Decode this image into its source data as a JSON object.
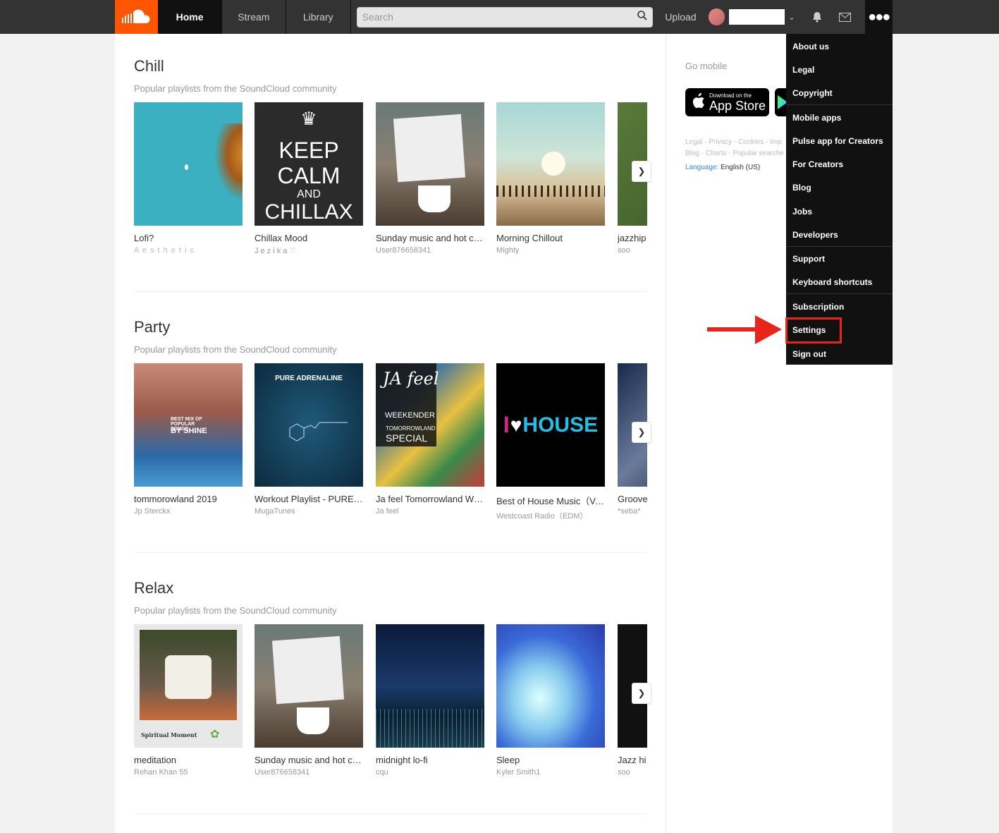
{
  "nav": {
    "tabs": [
      {
        "label": "Home"
      },
      {
        "label": "Stream"
      },
      {
        "label": "Library"
      }
    ],
    "search_placeholder": "Search",
    "upload_label": "Upload"
  },
  "sections": [
    {
      "title": "Chill",
      "subtitle": "Popular playlists from the SoundCloud community",
      "cards": [
        {
          "title": "Lofi?",
          "user": "A e s t h e t i c"
        },
        {
          "title": "Chillax Mood",
          "user": "J e z i k a ♡",
          "art_text": [
            "KEEP",
            "CALM",
            "AND",
            "CHILLAX"
          ]
        },
        {
          "title": "Sunday music and hot cof...",
          "user": "User876658341"
        },
        {
          "title": "Morning Chillout",
          "user": "Mighty"
        },
        {
          "title": "jazzhip",
          "user": "soo"
        }
      ]
    },
    {
      "title": "Party",
      "subtitle": "Popular playlists from the SoundCloud community",
      "cards": [
        {
          "title": "tommorowland 2019",
          "user": "Jp Sterckx",
          "art_text": [
            "BEST MIX OF POPULAR SONGS",
            "BY SHINE"
          ]
        },
        {
          "title": "Workout Playlist - PURE A...",
          "user": "MugaTunes",
          "art_text": [
            "PURE ADRENALINE"
          ]
        },
        {
          "title": "Ja feel Tomorrowland We...",
          "user": "Ja feel",
          "art_text": [
            "JA feel",
            "WEEKENDER",
            "TOMORROWLAND",
            "SPECIAL"
          ]
        },
        {
          "title": "Best of House Music（Vol....",
          "user": "Westcoast Radio（EDM）",
          "art_text": [
            "I",
            "HOUSE"
          ]
        },
        {
          "title": "Groove",
          "user": "*seba*"
        }
      ]
    },
    {
      "title": "Relax",
      "subtitle": "Popular playlists from the SoundCloud community",
      "cards": [
        {
          "title": "meditation",
          "user": "Rehan Khan 55",
          "art_text": [
            "Spiritual Moment"
          ]
        },
        {
          "title": "Sunday music and hot cof...",
          "user": "User876658341"
        },
        {
          "title": "midnight lo-fi",
          "user": "cqu"
        },
        {
          "title": "Sleep",
          "user": "Kyler Smith1"
        },
        {
          "title": "Jazz hi",
          "user": "soo"
        }
      ]
    }
  ],
  "sidebar": {
    "go_mobile": "Go mobile",
    "appstore_small": "Download on the",
    "appstore_big": "App Store",
    "links_line1": "Legal - Privacy - Cookies - Imp",
    "links_line2": "Blog - Charts - Popular searche",
    "language_label": "Language:",
    "language_value": "English (US)"
  },
  "menu": {
    "items": [
      {
        "label": "About us"
      },
      {
        "label": "Legal"
      },
      {
        "label": "Copyright"
      },
      {
        "label": "Mobile apps"
      },
      {
        "label": "Pulse app for Creators"
      },
      {
        "label": "For Creators"
      },
      {
        "label": "Blog"
      },
      {
        "label": "Jobs"
      },
      {
        "label": "Developers"
      },
      {
        "label": "Support"
      },
      {
        "label": "Keyboard shortcuts"
      },
      {
        "label": "Subscription"
      },
      {
        "label": "Settings"
      },
      {
        "label": "Sign out"
      }
    ]
  },
  "colors": {
    "brand": "#ff5500",
    "highlight": "#e8251c"
  }
}
